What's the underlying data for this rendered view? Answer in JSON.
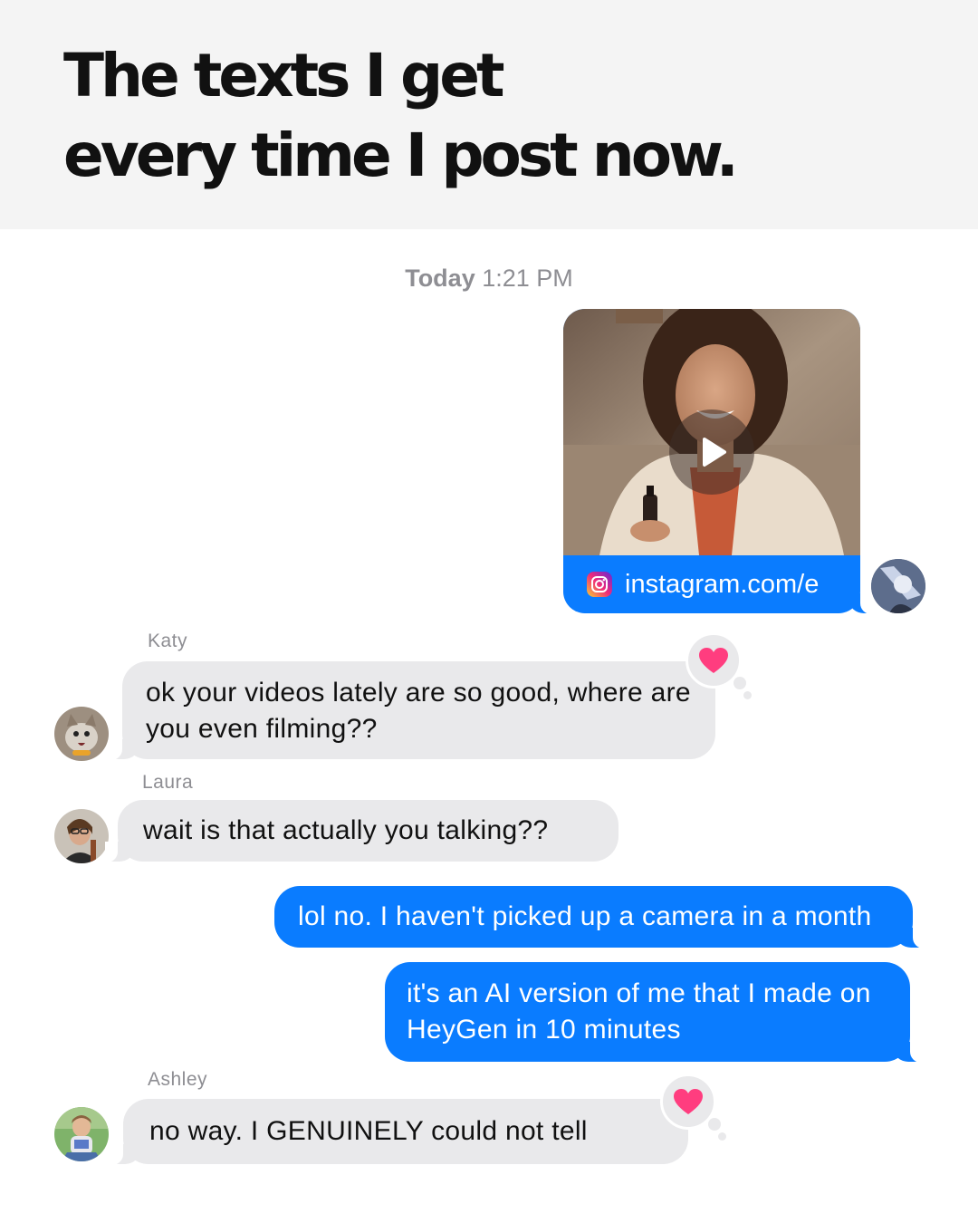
{
  "headline": {
    "line1": "The texts I get",
    "line2": "every time I post now."
  },
  "timestamp": {
    "day": "Today",
    "time": "1:21 PM"
  },
  "shared_post": {
    "link_text": "instagram.com/e",
    "link_icon": "instagram-icon",
    "play_icon": "play-icon"
  },
  "messages": [
    {
      "sender": "Katy",
      "text": "ok your videos lately are so good, where are you even filming??",
      "reaction": "heart",
      "direction": "incoming"
    },
    {
      "sender": "Laura",
      "text": "wait is that actually you talking??",
      "direction": "incoming"
    },
    {
      "text": "lol no. I haven't picked up a camera in a month",
      "direction": "outgoing"
    },
    {
      "text": "it's an AI version of me that I made on HeyGen in 10 minutes",
      "direction": "outgoing"
    },
    {
      "sender": "Ashley",
      "text": "no way. I GENUINELY could not tell",
      "reaction": "heart",
      "direction": "incoming"
    }
  ],
  "colors": {
    "header_bg": "#f4f4f4",
    "outgoing_bubble": "#0a7cff",
    "incoming_bubble": "#e9e9eb",
    "heart": "#ff3d7f",
    "meta_text": "#8e8e93"
  }
}
